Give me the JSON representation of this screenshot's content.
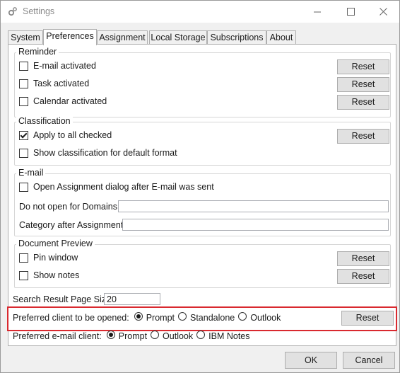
{
  "window": {
    "title": "Settings",
    "minimize_icon": "minimize-icon",
    "maximize_icon": "maximize-icon",
    "close_icon": "close-icon"
  },
  "tabs": [
    {
      "label": "System"
    },
    {
      "label": "Preferences",
      "active": true
    },
    {
      "label": "Assignment"
    },
    {
      "label": "Local Storage"
    },
    {
      "label": "Subscriptions"
    },
    {
      "label": "About"
    }
  ],
  "reminder": {
    "title": "Reminder",
    "items": [
      {
        "label": "E-mail activated",
        "checked": false,
        "button": "Reset"
      },
      {
        "label": "Task activated",
        "checked": false,
        "button": "Reset"
      },
      {
        "label": "Calendar activated",
        "checked": false,
        "button": "Reset"
      }
    ]
  },
  "classification": {
    "title": "Classification",
    "items": [
      {
        "label": "Apply to all checked",
        "checked": true,
        "button": "Reset"
      },
      {
        "label": "Show classification for default format",
        "checked": false
      }
    ]
  },
  "email": {
    "title": "E-mail",
    "open_assignment": {
      "label": "Open Assignment dialog after E-mail was sent",
      "checked": false
    },
    "do_not_open_label": "Do not open for Domains",
    "do_not_open_value": "",
    "category_label": "Category after Assignment",
    "category_value": ""
  },
  "document_preview": {
    "title": "Document Preview",
    "items": [
      {
        "label": "Pin window",
        "checked": false,
        "button": "Reset"
      },
      {
        "label": "Show notes",
        "checked": false,
        "button": "Reset"
      }
    ]
  },
  "search_page_size": {
    "label": "Search Result Page Size",
    "value": "20"
  },
  "preferred_client": {
    "label": "Preferred client to be opened:",
    "options": [
      "Prompt",
      "Standalone",
      "Outlook"
    ],
    "selected": "Prompt",
    "button": "Reset",
    "highlight_color": "#d9292f"
  },
  "preferred_email": {
    "label": "Preferred e-mail client:",
    "options": [
      "Prompt",
      "Outlook",
      "IBM Notes"
    ],
    "selected": "Prompt"
  },
  "footer": {
    "ok": "OK",
    "cancel": "Cancel"
  }
}
